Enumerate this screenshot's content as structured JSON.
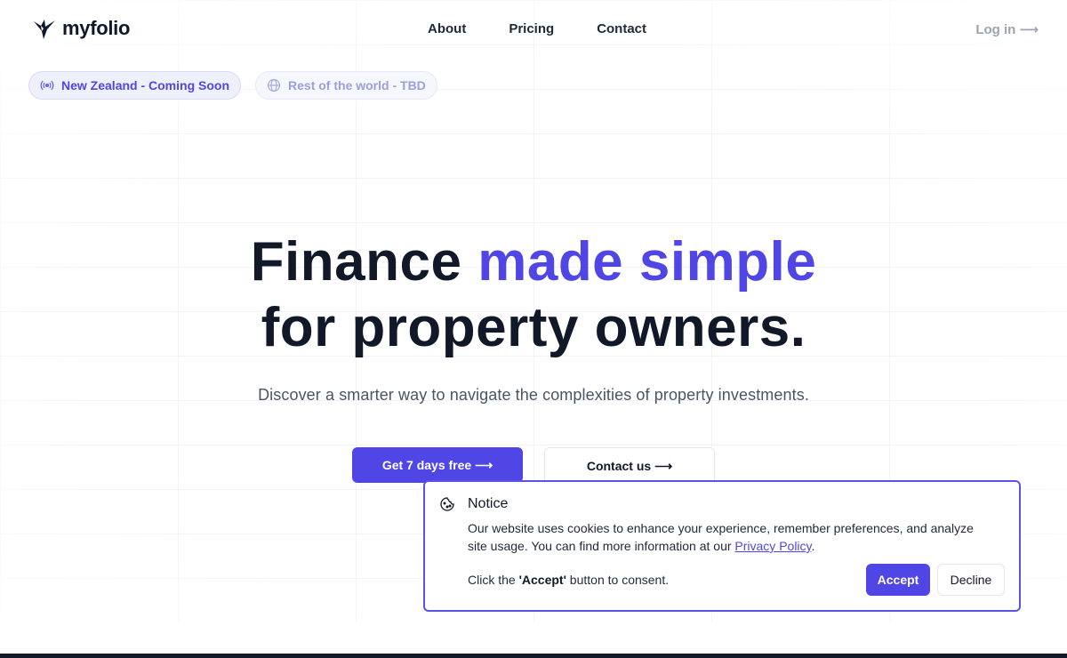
{
  "brand": {
    "name": "myfolio"
  },
  "nav": {
    "items": [
      "About",
      "Pricing",
      "Contact"
    ],
    "login": "Log in ⟶"
  },
  "regions": [
    {
      "label": "New Zealand - Coming Soon",
      "icon": "broadcast-icon",
      "active": true
    },
    {
      "label": "Rest of the world - TBD",
      "icon": "globe-icon",
      "active": false
    }
  ],
  "hero": {
    "title_part1": "Finance ",
    "title_accent": "made simple",
    "title_line2": "for property owners.",
    "subtitle": "Discover a smarter way to navigate the complexities of property investments.",
    "cta_primary": "Get 7 days free ⟶",
    "cta_secondary": "Contact us ⟶"
  },
  "cookie": {
    "title": "Notice",
    "body_text": "Our website uses cookies to enhance your experience, remember preferences, and analyze site usage. You can find more information at our ",
    "policy_link": "Privacy Policy",
    "body_end": ".",
    "consent_prefix": "Click the ",
    "consent_bold": "'Accept'",
    "consent_suffix": " button to consent.",
    "accept_label": "Accept",
    "decline_label": "Decline"
  },
  "colors": {
    "accent": "#4f46e5",
    "text": "#111827",
    "muted": "#4b5563"
  }
}
